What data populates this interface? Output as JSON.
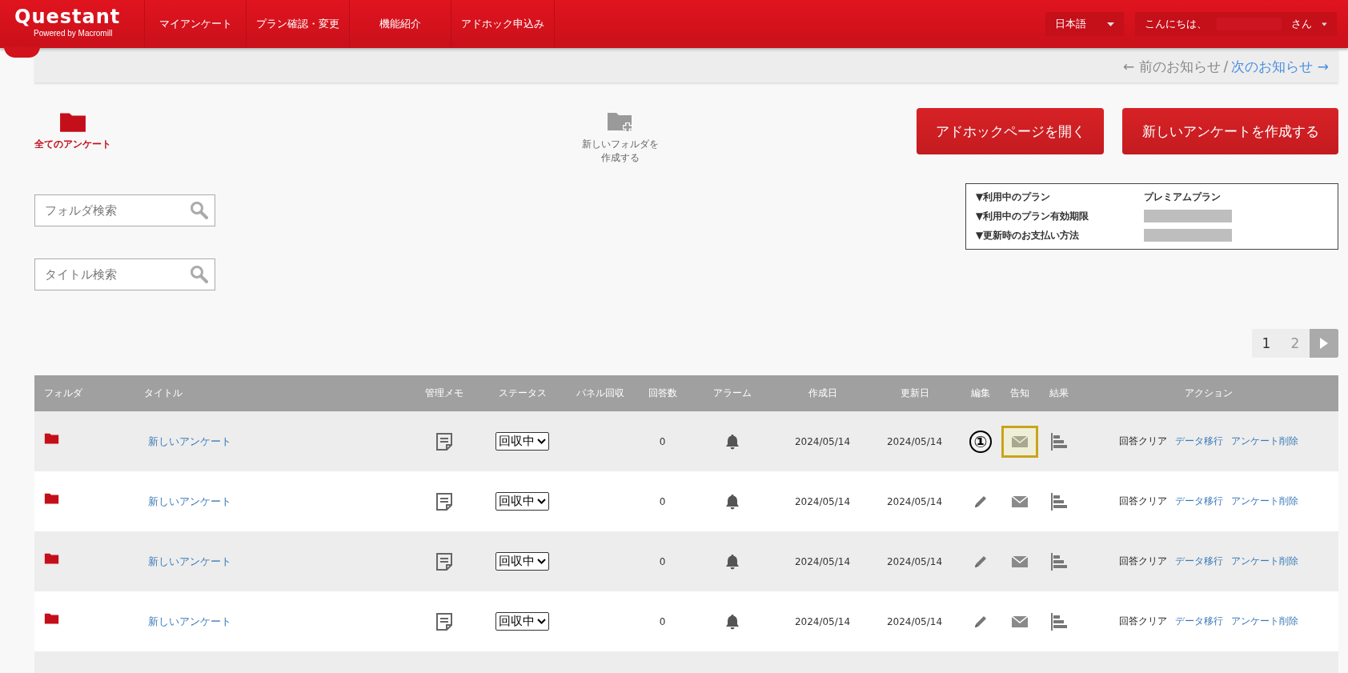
{
  "header": {
    "logo": "Questant",
    "logo_tagline": "Powered by Macromill",
    "nav": [
      "マイアンケート",
      "プラン確認・変更",
      "機能紹介",
      "アドホック申込み"
    ],
    "language": "日本語",
    "greeting": "こんにちは、",
    "greeting_suffix": "さん"
  },
  "notice": {
    "prev": "← 前のお知らせ",
    "separator": "/",
    "next": "次のお知らせ →"
  },
  "folders": [
    {
      "label": "全てのアンケート",
      "kind": "folder",
      "selected": true
    },
    {
      "label_lines": [
        "新しいフォルダを",
        "作成する"
      ],
      "kind": "new_folder",
      "selected": false
    }
  ],
  "search_fields": [
    {
      "placeholder": "フォルダ検索"
    },
    {
      "placeholder": "タイトル検索"
    }
  ],
  "buttons": [
    "アドホックページを開く",
    "新しいアンケートを作成する"
  ],
  "plan": [
    {
      "label": "▼利用中のプラン",
      "value": "プレミアムプラン",
      "redacted": false
    },
    {
      "label": "▼利用中のプラン有効期限",
      "redacted": true
    },
    {
      "label": "▼更新時のお支払い方法",
      "redacted": true
    }
  ],
  "pagination": [
    {
      "label": "1",
      "selected": true
    },
    {
      "label": "2",
      "selected": false
    }
  ],
  "table": {
    "columns": [
      "フォルダ",
      "タイトル",
      "管理メモ",
      "ステータス",
      "パネル回収",
      "回答数",
      "アラーム",
      "作成日",
      "更新日",
      "編集",
      "告知",
      "結果",
      "アクション"
    ],
    "rows": [
      {
        "title": "新しいアンケート",
        "status": "回収中",
        "responses": "0",
        "created": "2024/05/14",
        "updated": "2024/05/14",
        "callout": "①",
        "notify_highlighted": true,
        "actions": [
          {
            "label": "回答クリア",
            "kind": "plain"
          },
          {
            "label": "データ移行",
            "kind": "link"
          },
          {
            "label": "アンケート削除",
            "kind": "link"
          }
        ]
      },
      {
        "title": "新しいアンケート",
        "status": "回収中",
        "responses": "0",
        "created": "2024/05/14",
        "updated": "2024/05/14",
        "notify_highlighted": false,
        "actions": [
          {
            "label": "回答クリア",
            "kind": "plain"
          },
          {
            "label": "データ移行",
            "kind": "link"
          },
          {
            "label": "アンケート削除",
            "kind": "link"
          }
        ]
      },
      {
        "title": "新しいアンケート",
        "status": "回収中",
        "responses": "0",
        "created": "2024/05/14",
        "updated": "2024/05/14",
        "notify_highlighted": false,
        "actions": [
          {
            "label": "回答クリア",
            "kind": "plain"
          },
          {
            "label": "データ移行",
            "kind": "link"
          },
          {
            "label": "アンケート削除",
            "kind": "link"
          }
        ]
      },
      {
        "title": "新しいアンケート",
        "status": "回収中",
        "responses": "0",
        "created": "2024/05/14",
        "updated": "2024/05/14",
        "notify_highlighted": false,
        "actions": [
          {
            "label": "回答クリア",
            "kind": "plain"
          },
          {
            "label": "データ移行",
            "kind": "link"
          },
          {
            "label": "アンケート削除",
            "kind": "link"
          }
        ]
      }
    ]
  }
}
